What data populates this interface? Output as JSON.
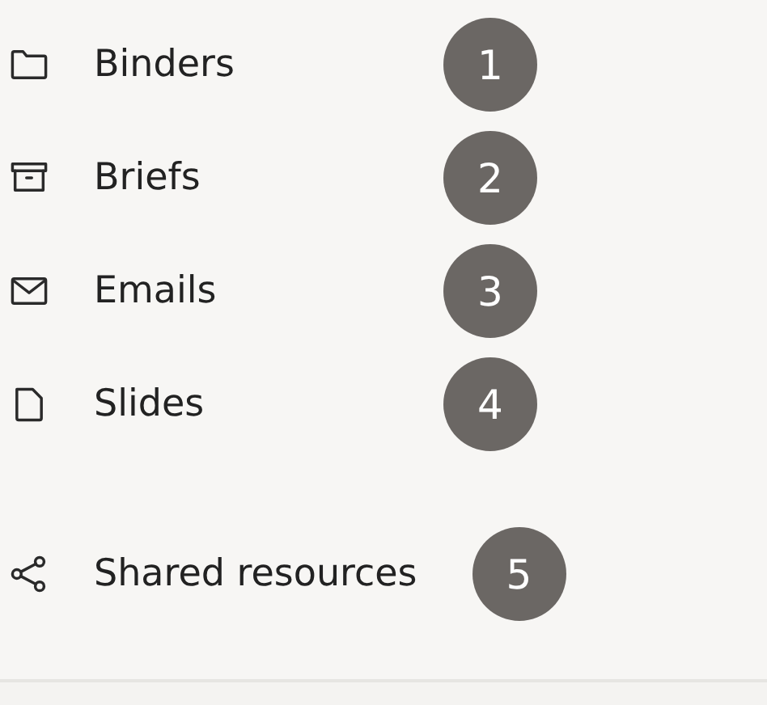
{
  "nav_items": [
    {
      "label": "Binders",
      "badge": "1"
    },
    {
      "label": "Briefs",
      "badge": "2"
    },
    {
      "label": "Emails",
      "badge": "3"
    },
    {
      "label": "Slides",
      "badge": "4"
    }
  ],
  "shared_item": {
    "label": "Shared resources",
    "badge": "5"
  }
}
